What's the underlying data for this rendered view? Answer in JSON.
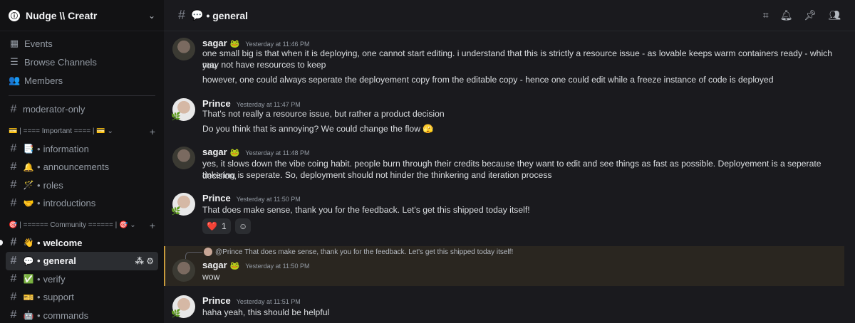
{
  "server": {
    "name": "Nudge \\\\ Creatr"
  },
  "sidebar": {
    "top_items": [
      {
        "icon": "calendar-icon",
        "label": "Events"
      },
      {
        "icon": "browse-channels-icon",
        "label": "Browse Channels"
      },
      {
        "icon": "members-icon",
        "label": "Members"
      }
    ],
    "moderator_channel": "moderator-only",
    "cat_important": "| ==== Important ==== |",
    "cat_community": "| ====== Community ====== |",
    "important_channels": [
      {
        "emoji": "📑",
        "label": "information"
      },
      {
        "emoji": "🔔",
        "label": "announcements"
      },
      {
        "emoji": "🪄",
        "label": "roles"
      },
      {
        "emoji": "🤝",
        "label": "introductions"
      }
    ],
    "community_channels": [
      {
        "emoji": "👋",
        "label": "welcome"
      },
      {
        "emoji": "💬",
        "label": "general"
      },
      {
        "emoji": "✅",
        "label": "verify"
      },
      {
        "emoji": "🎫",
        "label": "support"
      },
      {
        "emoji": "🤖",
        "label": "commands"
      }
    ]
  },
  "channel": {
    "emoji": "💬",
    "name": "general"
  },
  "messages": [
    {
      "user": "sagar",
      "time": "Yesterday at 11:46 PM",
      "lines": [
        "one small big is that when it is deploying, one cannot start editing. i understand that this is strictly a resource issue - as lovable keeps warm containers ready - which you",
        "may not have resources to keep",
        "however, one could always seperate the deployement copy from the editable copy - hence one could edit while a freeze instance of code is deployed"
      ]
    },
    {
      "user": "Prince",
      "time": "Yesterday at 11:47 PM",
      "lines": [
        "That's not really a resource issue, but rather a product decision",
        "Do you think that is annoying? We could change the flow 🫣"
      ]
    },
    {
      "user": "sagar",
      "time": "Yesterday at 11:48 PM",
      "lines": [
        "yes, it slows down the vibe coing habit. people burn through their credits because they want to edit and see things as fast as possible. Deployement is a seperate decision,",
        "tinkering is seperate. So, deployment should not hinder the thinkering and iteration process"
      ]
    },
    {
      "user": "Prince",
      "time": "Yesterday at 11:50 PM",
      "lines": [
        "That does make sense, thank you for the feedback. Let's get this shipped today itself!"
      ],
      "reaction": {
        "emoji": "❤️",
        "count": "1"
      }
    },
    {
      "user": "sagar",
      "time": "Yesterday at 11:50 PM",
      "reply_to": "@Prince That does make sense, thank you for the feedback. Let's get this shipped today itself!",
      "lines": [
        "wow"
      ]
    },
    {
      "user": "Prince",
      "time": "Yesterday at 11:51 PM",
      "lines": [
        "haha yeah, this should be helpful"
      ]
    }
  ]
}
